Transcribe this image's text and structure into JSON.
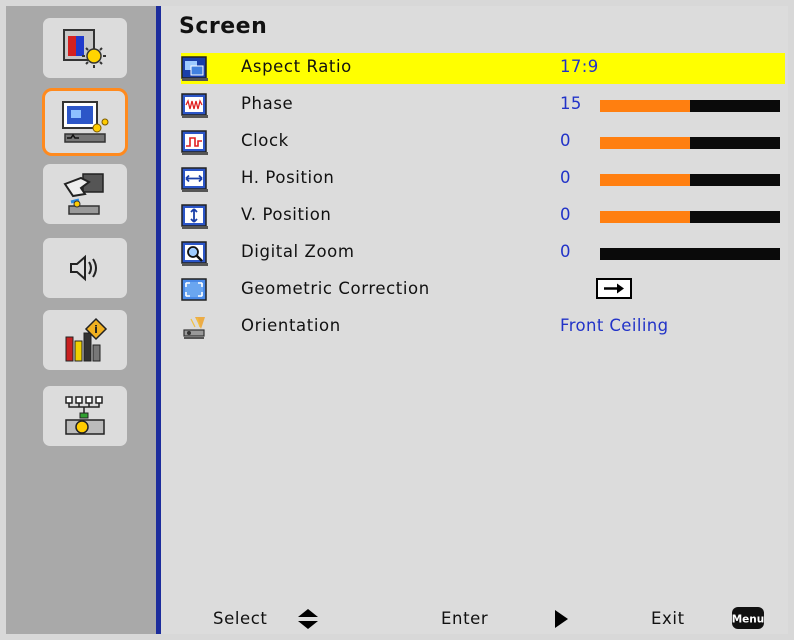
{
  "sidebar": {
    "items": [
      {
        "icon": "image-settings-icon",
        "selected": false
      },
      {
        "icon": "screen-settings-icon",
        "selected": true
      },
      {
        "icon": "setup-hand-icon",
        "selected": false
      },
      {
        "icon": "volume-icon",
        "selected": false
      },
      {
        "icon": "options-info-icon",
        "selected": false
      },
      {
        "icon": "network-projector-icon",
        "selected": false
      }
    ]
  },
  "header": {
    "title": "Screen"
  },
  "menu": [
    {
      "id": "aspect-ratio",
      "label": "Aspect Ratio",
      "value": "17:9",
      "icon": "aspect-ratio-icon",
      "highlighted": true
    },
    {
      "id": "phase",
      "label": "Phase",
      "value": "15",
      "icon": "phase-icon",
      "level": 0.5
    },
    {
      "id": "clock",
      "label": "Clock",
      "value": "0",
      "icon": "clock-icon",
      "level": 0.5
    },
    {
      "id": "h-position",
      "label": "H. Position",
      "value": "0",
      "icon": "h-position-icon",
      "level": 0.5
    },
    {
      "id": "v-position",
      "label": "V. Position",
      "value": "0",
      "icon": "v-position-icon",
      "level": 0.5
    },
    {
      "id": "digital-zoom",
      "label": "Digital Zoom",
      "value": "0",
      "icon": "digital-zoom-icon",
      "level": 0.0
    },
    {
      "id": "geometric-correction",
      "label": "Geometric Correction",
      "icon": "geometric-correction-icon",
      "action": "arrow-right-icon"
    },
    {
      "id": "orientation",
      "label": "Orientation",
      "value": "Front Ceiling",
      "icon": "orientation-icon"
    }
  ],
  "footer": {
    "select_label": "Select",
    "enter_label": "Enter",
    "exit_label": "Exit",
    "menu_key_label": "Menu"
  },
  "colors": {
    "highlight": "#ffff00",
    "value_text": "#2233c8",
    "slider_fill": "#ff7f10",
    "slider_track": "#0a0a0a",
    "selected_border": "#ff8a1e",
    "divider": "#1c2c9c"
  }
}
